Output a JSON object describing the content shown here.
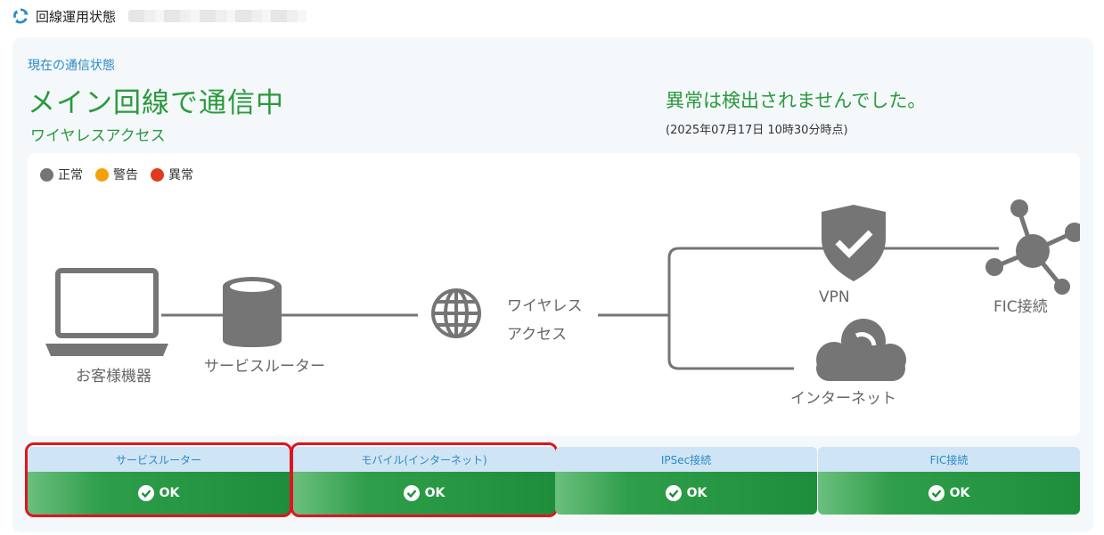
{
  "app": {
    "title": "回線運用状態",
    "logo_icon": "cycle-arrows-icon",
    "accent": "#2a8ac6"
  },
  "status": {
    "current_label": "現在の通信状態",
    "main_title": "メイン回線で通信中",
    "sub_title": "ワイヤレスアクセス",
    "anomaly_text": "異常は検出されませんでした。",
    "timestamp": "(2025年07月17日 10時30分時点)",
    "status_color": "#2a9a3c"
  },
  "legend": [
    {
      "label": "正常",
      "color": "#757575"
    },
    {
      "label": "警告",
      "color": "#f4a20b"
    },
    {
      "label": "異常",
      "color": "#e03a1e"
    }
  ],
  "diagram": {
    "customer_device": "お客様機器",
    "service_router": "サービスルーター",
    "wireless_line1": "ワイヤレス",
    "wireless_line2": "アクセス",
    "vpn": "VPN",
    "fic": "FIC接続",
    "internet": "インターネット",
    "icons": [
      "laptop-icon",
      "router-icon",
      "globe-icon",
      "shield-check-icon",
      "hub-network-icon",
      "cloud-icon"
    ]
  },
  "cards": [
    {
      "title": "サービスルーター",
      "status": "OK",
      "highlighted": true
    },
    {
      "title": "モバイル(インターネット)",
      "status": "OK",
      "highlighted": true
    },
    {
      "title": "IPSec接続",
      "status": "OK",
      "highlighted": false
    },
    {
      "title": "FIC接続",
      "status": "OK",
      "highlighted": false
    }
  ]
}
